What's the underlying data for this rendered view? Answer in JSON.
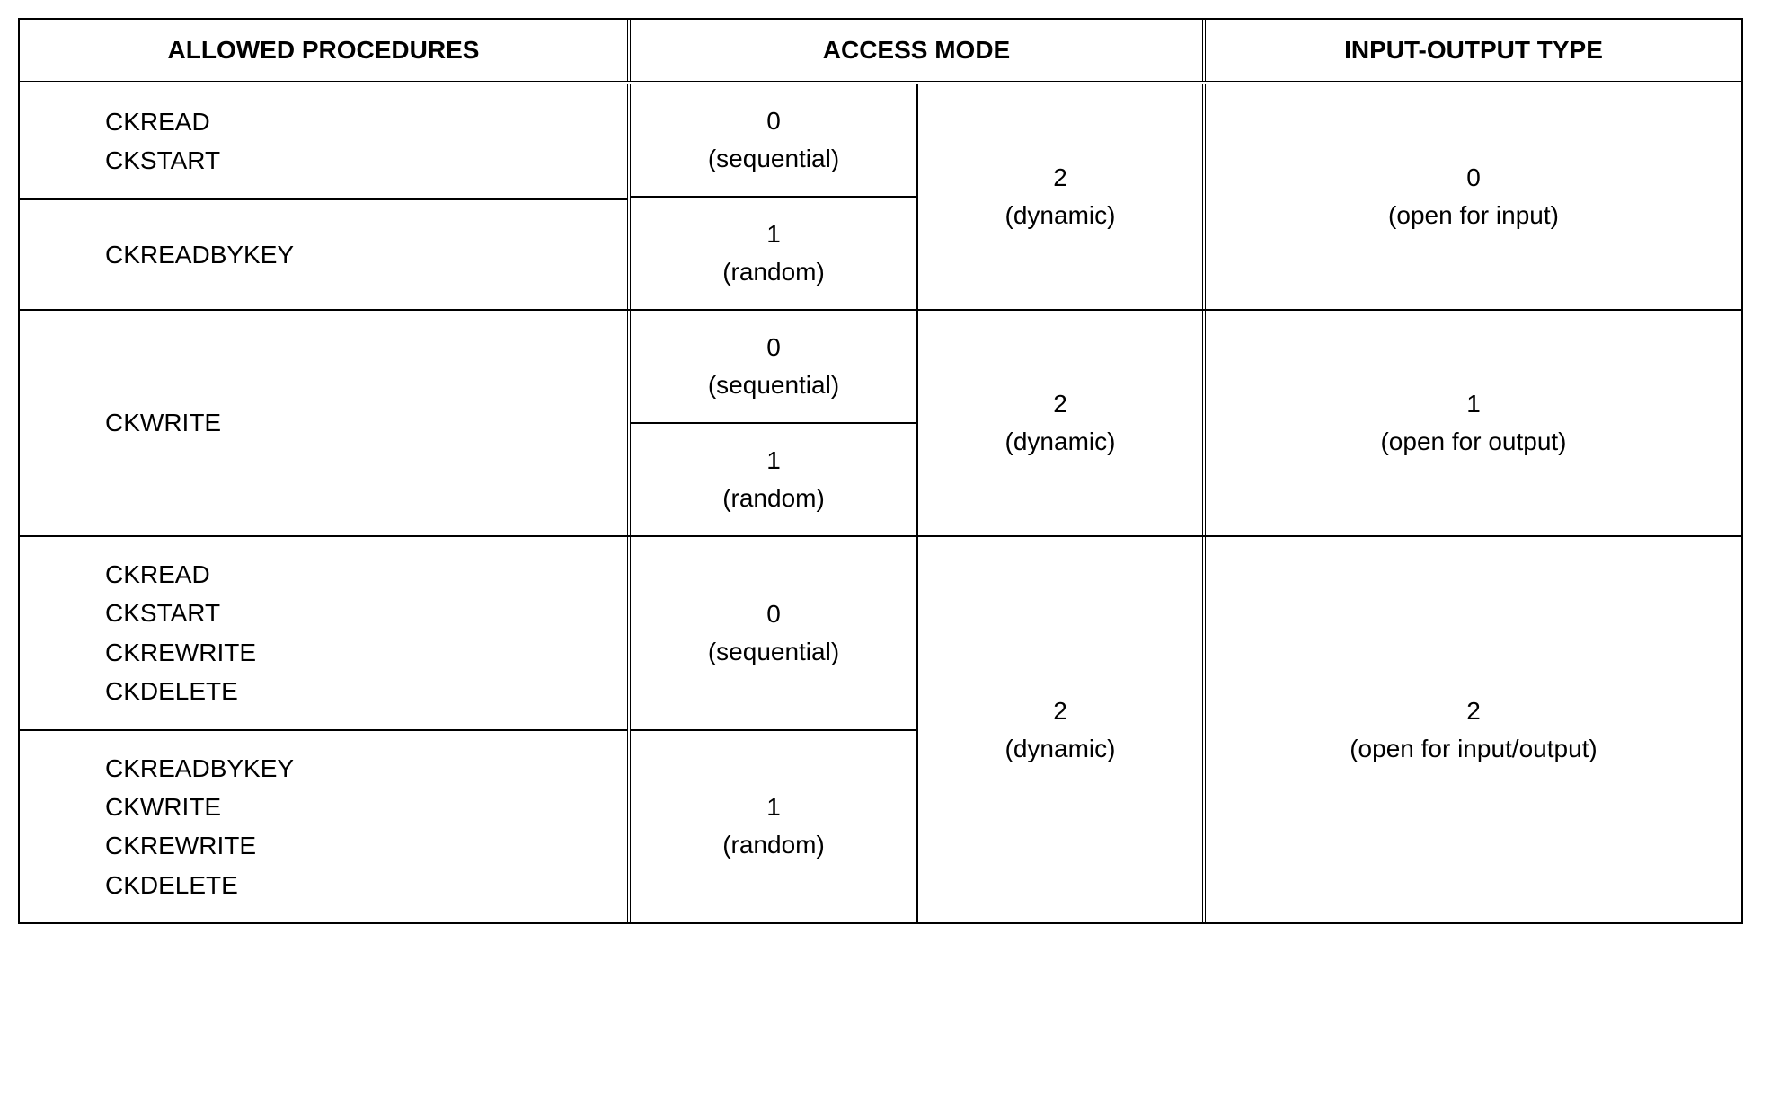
{
  "headers": {
    "procedures": "ALLOWED PROCEDURES",
    "access_mode": "ACCESS MODE",
    "io_type": "INPUT-OUTPUT TYPE"
  },
  "groups": [
    {
      "left": [
        {
          "lines": [
            "CKREAD",
            "CKSTART"
          ]
        },
        {
          "lines": [
            "CKREADBYKEY"
          ]
        }
      ],
      "mid_a": [
        {
          "val": "0",
          "note": "(sequential)"
        },
        {
          "val": "1",
          "note": "(random)"
        }
      ],
      "mid_b": {
        "val": "2",
        "note": "(dynamic)"
      },
      "right": {
        "val": "0",
        "note": "(open for input)"
      }
    },
    {
      "left": [
        {
          "lines": [
            "CKWRITE"
          ]
        }
      ],
      "left_merged": true,
      "mid_a": [
        {
          "val": "0",
          "note": "(sequential)"
        },
        {
          "val": "1",
          "note": "(random)"
        }
      ],
      "mid_b": {
        "val": "2",
        "note": "(dynamic)"
      },
      "right": {
        "val": "1",
        "note": "(open for output)"
      }
    },
    {
      "left": [
        {
          "lines": [
            "CKREAD",
            "CKSTART",
            "CKREWRITE",
            "CKDELETE"
          ]
        },
        {
          "lines": [
            "CKREADBYKEY",
            "CKWRITE",
            "CKREWRITE",
            "CKDELETE"
          ]
        }
      ],
      "mid_a": [
        {
          "val": "0",
          "note": "(sequential)"
        },
        {
          "val": "1",
          "note": "(random)"
        }
      ],
      "mid_b": {
        "val": "2",
        "note": "(dynamic)"
      },
      "right": {
        "val": "2",
        "note": "(open for input/output)"
      }
    }
  ]
}
